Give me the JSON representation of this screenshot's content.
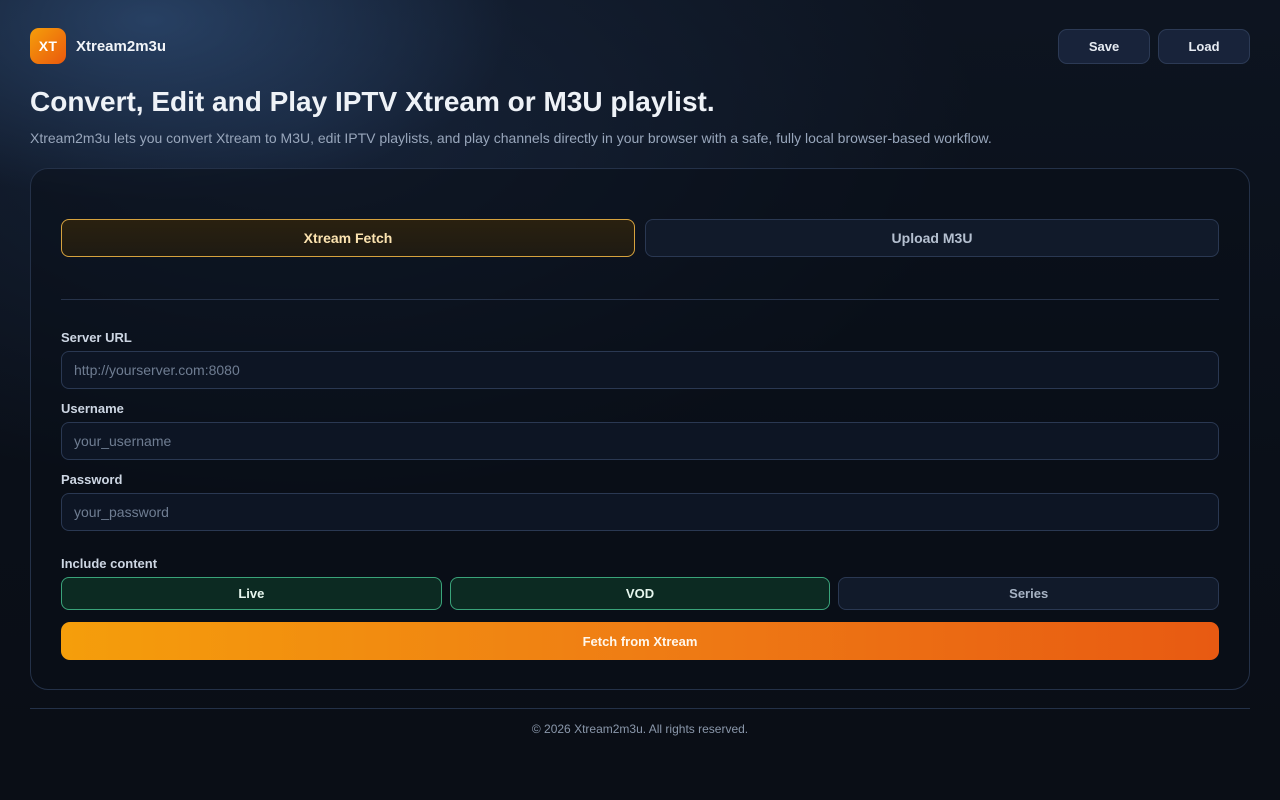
{
  "header": {
    "logo_text": "XT",
    "app_name": "Xtream2m3u",
    "save_label": "Save",
    "load_label": "Load"
  },
  "hero": {
    "title": "Convert, Edit and Play IPTV Xtream or M3U playlist.",
    "subtitle": "Xtream2m3u lets you convert Xtream to M3U, edit IPTV playlists, and play channels directly in your browser with a safe, fully local browser-based workflow."
  },
  "tabs": [
    {
      "label": "Xtream Fetch",
      "active": true
    },
    {
      "label": "Upload M3U",
      "active": false
    }
  ],
  "form": {
    "server_url": {
      "label": "Server URL",
      "value": "",
      "placeholder": "http://yourserver.com:8080"
    },
    "username": {
      "label": "Username",
      "value": "",
      "placeholder": "your_username"
    },
    "password": {
      "label": "Password",
      "value": "",
      "placeholder": "your_password"
    },
    "include_label": "Include content",
    "content_types": [
      {
        "label": "Live",
        "selected": true
      },
      {
        "label": "VOD",
        "selected": true
      },
      {
        "label": "Series",
        "selected": false
      }
    ],
    "submit_label": "Fetch from Xtream"
  },
  "footer": {
    "copyright": "© 2026 Xtream2m3u. All rights reserved."
  },
  "colors": {
    "accent_orange": "#f59e0b",
    "accent_orange_end": "#e85a12",
    "selected_green": "#3aa37a",
    "background": "#0a0f18"
  }
}
